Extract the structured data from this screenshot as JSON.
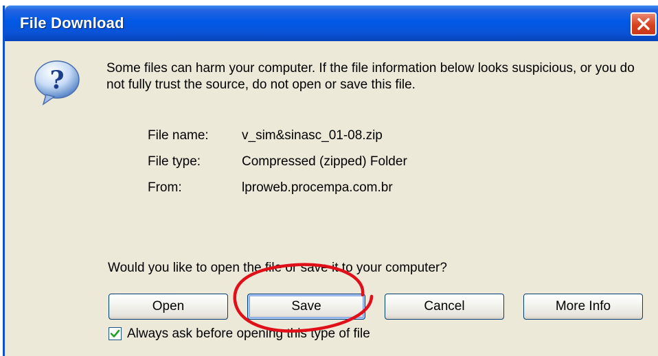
{
  "window": {
    "title": "File Download",
    "close_icon": "close-icon"
  },
  "message": {
    "icon": "question-icon",
    "text": "Some files can harm your computer. If the file information below looks suspicious, or you do not fully trust the source, do not open or save this file."
  },
  "file_info": {
    "name_label": "File name:",
    "name_value": "v_sim&sinasc_01-08.zip",
    "type_label": "File type:",
    "type_value": "Compressed (zipped) Folder",
    "from_label": "From:",
    "from_value": "lproweb.procempa.com.br"
  },
  "prompt": "Would you like to open the file or save it to your computer?",
  "buttons": {
    "open": "Open",
    "save": "Save",
    "cancel": "Cancel",
    "more_info": "More Info"
  },
  "checkbox": {
    "label": "Always ask before opening this type of file",
    "checked": true
  },
  "colors": {
    "titlebar": "#0058e6",
    "dialog_bg": "#ece9d8",
    "annotation": "#e0101a"
  }
}
